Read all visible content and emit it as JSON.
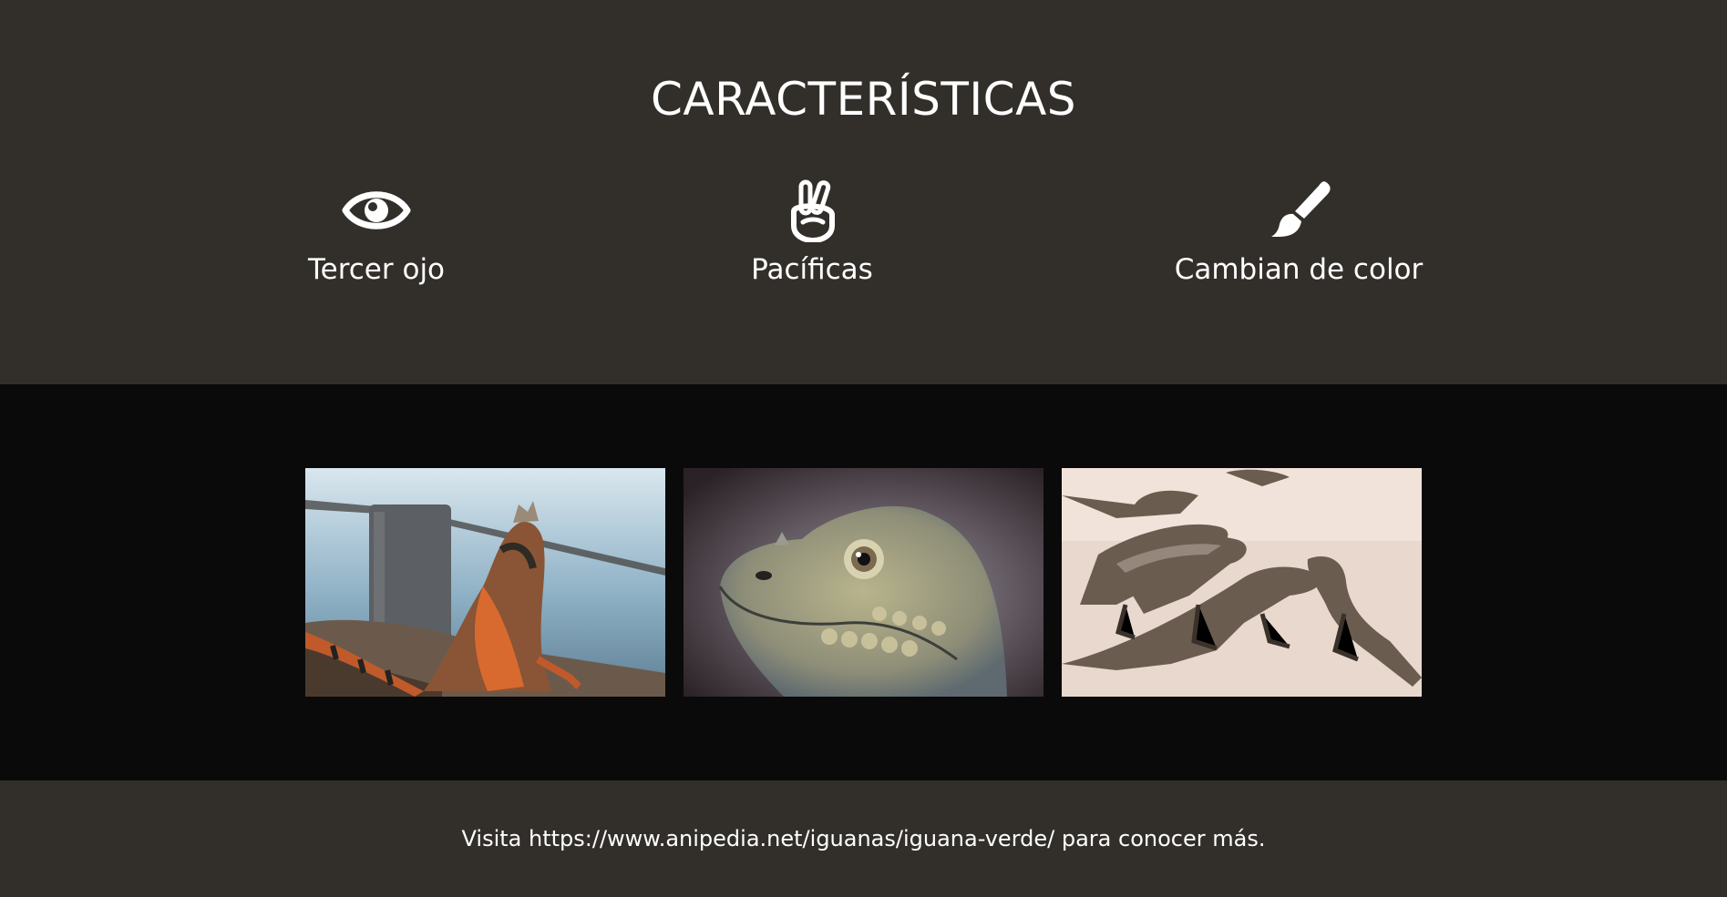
{
  "features": {
    "title": "CARACTERÍSTICAS",
    "items": [
      {
        "label": "Tercer ojo",
        "icon": "eye-icon"
      },
      {
        "label": "Pacíficas",
        "icon": "peace-hand-icon"
      },
      {
        "label": "Cambian de color",
        "icon": "paint-brush-icon"
      }
    ]
  },
  "gallery": {
    "images": [
      {
        "name": "iguana-by-sea-photo"
      },
      {
        "name": "iguana-head-closeup-photo"
      },
      {
        "name": "iguanas-on-beach-photo"
      }
    ]
  },
  "footer": {
    "text": "Visita https://www.anipedia.net/iguanas/iguana-verde/ para conocer más."
  },
  "colors": {
    "section_bg": "#322f2a",
    "gallery_bg": "#0a0a0a",
    "text": "#ffffff"
  }
}
